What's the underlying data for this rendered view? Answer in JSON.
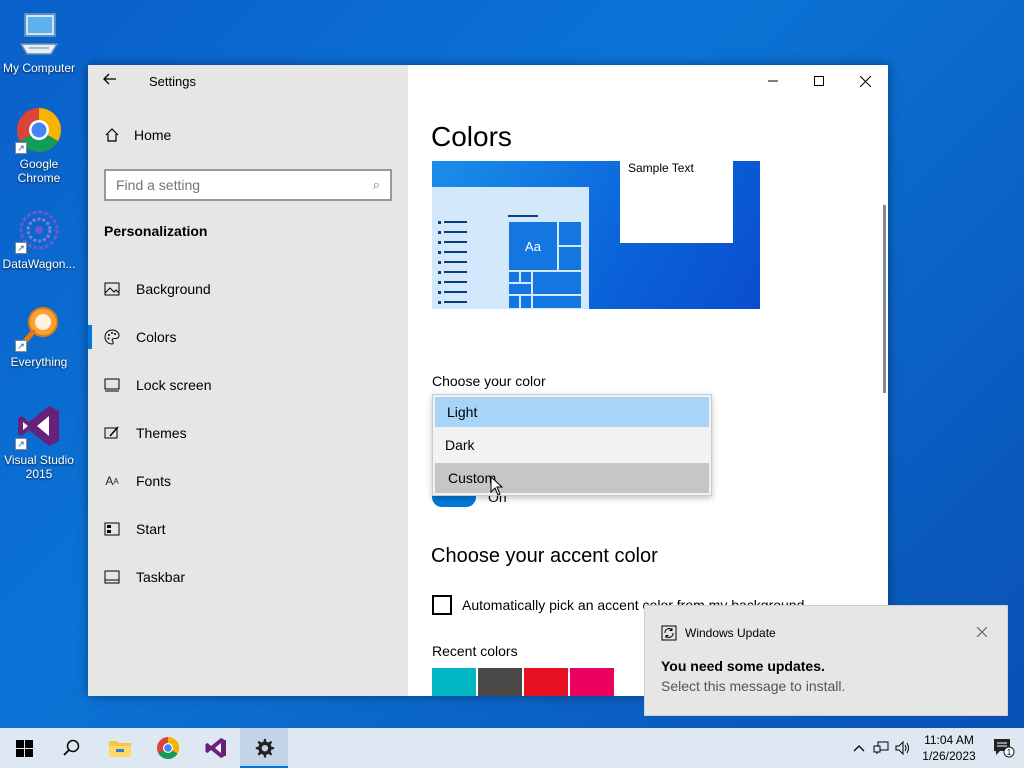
{
  "desktop": {
    "icons": [
      {
        "label": "My Computer",
        "icon": "computer-icon"
      },
      {
        "label": "Google Chrome",
        "icon": "chrome-icon"
      },
      {
        "label": "DataWagon...",
        "icon": "datawagon-icon"
      },
      {
        "label": "Everything",
        "icon": "everything-icon"
      },
      {
        "label": "Visual Studio 2015",
        "icon": "visual-studio-icon"
      }
    ]
  },
  "settings": {
    "title": "Settings",
    "home_label": "Home",
    "search_placeholder": "Find a setting",
    "section_title": "Personalization",
    "nav": [
      {
        "label": "Background",
        "icon": "picture-icon"
      },
      {
        "label": "Colors",
        "icon": "palette-icon",
        "active": true
      },
      {
        "label": "Lock screen",
        "icon": "lock-screen-icon"
      },
      {
        "label": "Themes",
        "icon": "themes-icon"
      },
      {
        "label": "Fonts",
        "icon": "fonts-icon"
      },
      {
        "label": "Start",
        "icon": "start-icon"
      },
      {
        "label": "Taskbar",
        "icon": "taskbar-icon"
      }
    ]
  },
  "colors_page": {
    "title": "Colors",
    "preview": {
      "sample_text": "Sample Text",
      "tile_label": "Aa"
    },
    "choose_color_label": "Choose your color",
    "color_options": [
      "Light",
      "Dark",
      "Custom"
    ],
    "selected_option": "Light",
    "hovered_option": "Custom",
    "toggle_label": "On",
    "accent_title": "Choose your accent color",
    "auto_pick_label": "Automatically pick an accent color from my background",
    "recent_colors_label": "Recent colors",
    "recent_colors": [
      "#00b7c3",
      "#4c4a48",
      "#e81123",
      "#ea005e"
    ]
  },
  "toast": {
    "app": "Windows Update",
    "title": "You need some updates.",
    "message": "Select this message to install."
  },
  "taskbar": {
    "time": "11:04 AM",
    "date": "1/26/2023",
    "notification_count": "1"
  },
  "colors": {
    "accent": "#0078d7",
    "desktop_bg": "#0b6fd2"
  }
}
